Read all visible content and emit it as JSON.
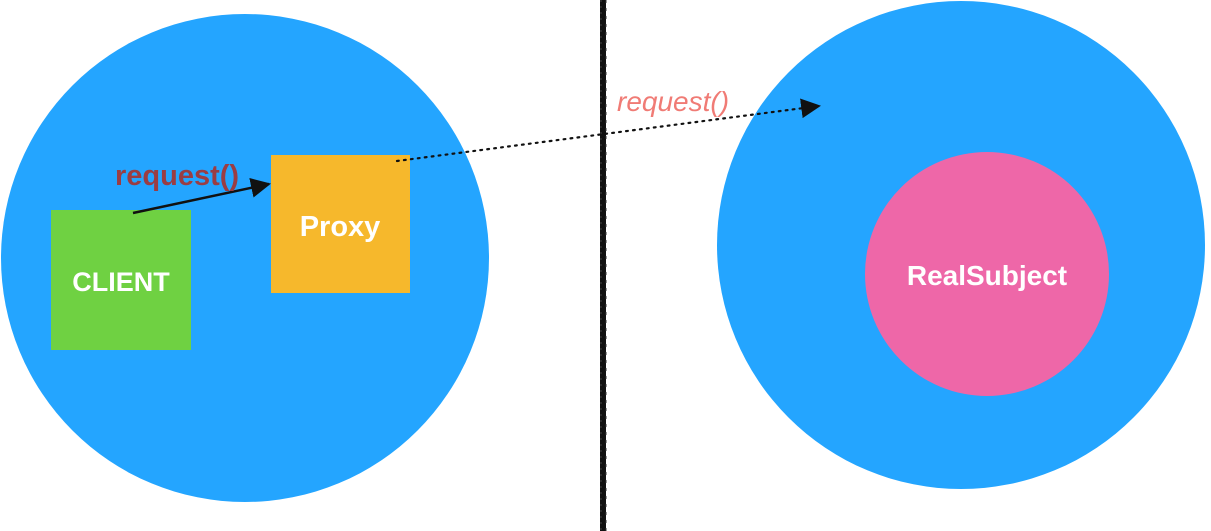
{
  "diagram": {
    "client_label": "CLIENT",
    "proxy_label": "Proxy",
    "real_subject_label": "RealSubject",
    "local_request_label": "request()",
    "remote_request_label": "request()"
  },
  "colors": {
    "circle_blue": "#24a5ff",
    "client_green": "#6fd142",
    "proxy_orange": "#f6b82c",
    "real_subject_pink": "#ee67a8",
    "local_request_text": "#9b3d43",
    "remote_request_text": "#f07b75",
    "divider": "#111111",
    "arrow": "#111111"
  }
}
